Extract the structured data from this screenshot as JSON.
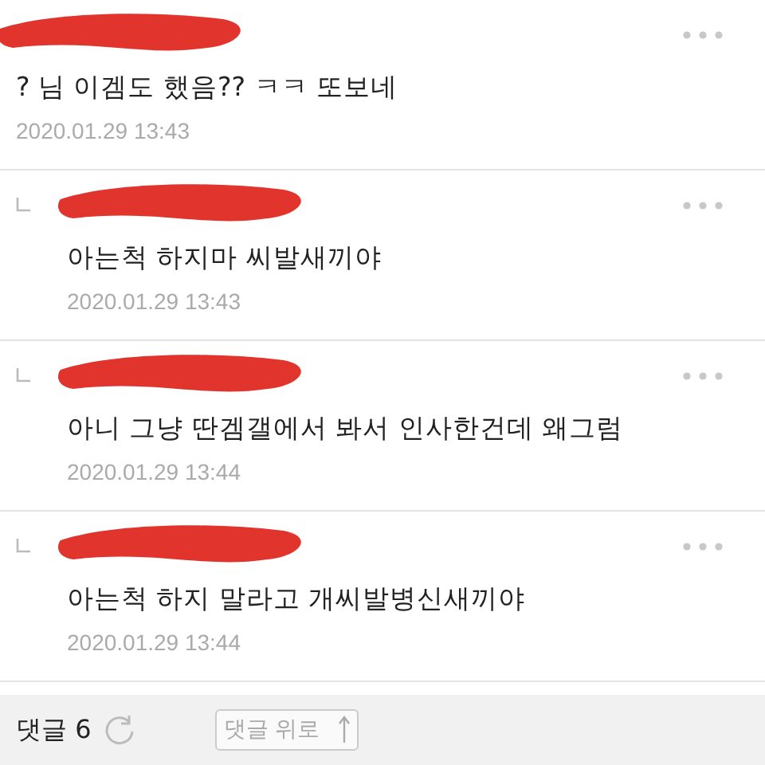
{
  "comments": [
    {
      "reply": false,
      "text": "? 님 이겜도 했음?? ㅋㅋ 또보네",
      "date": "2020.01.29 13:43"
    },
    {
      "reply": true,
      "text": "아는척 하지마 씨발새끼야",
      "date": "2020.01.29 13:43"
    },
    {
      "reply": true,
      "text": "아니 그냥 딴겜갤에서 봐서 인사한건데 왜그럼",
      "date": "2020.01.29 13:44"
    },
    {
      "reply": true,
      "text": "아는척 하지 말라고 개씨발병신새끼야",
      "date": "2020.01.29 13:44"
    }
  ],
  "footer": {
    "count_label": "댓글 6",
    "scroll_button": "댓글 위로"
  }
}
